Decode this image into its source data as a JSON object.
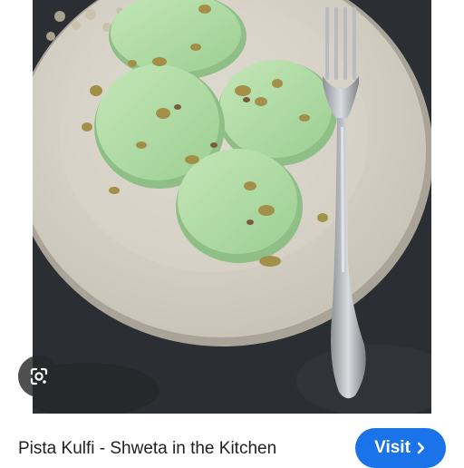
{
  "image": {
    "subject": "pistachio kulfi slices on a plate with a fork",
    "colors": {
      "background": "#2b2f33",
      "plate": "#ddd9cf",
      "kulfi": "#b5dca9",
      "kulfi_shadow": "#8fbf86",
      "pistachio": "#a39048",
      "fork": "#b8bcc0"
    }
  },
  "lens_button": {
    "icon": "lens-icon"
  },
  "result": {
    "title": "Pista Kulfi - Shweta in the Kitchen",
    "visit_label": "Visit",
    "visit_icon": "chevron-right-icon",
    "accent_color": "#1a73e8"
  }
}
